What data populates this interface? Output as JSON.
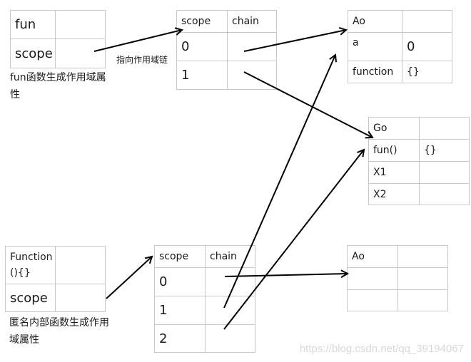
{
  "fun_box": {
    "rows": [
      {
        "key": "fun",
        "value": ""
      },
      {
        "key": "scope",
        "value": ""
      }
    ],
    "caption": "fun函数生成作用域属性"
  },
  "arrow_label": "指向作用域链",
  "scope_chain_top": {
    "header": {
      "key": "scope",
      "value": "chain"
    },
    "rows": [
      {
        "key": "0",
        "value": ""
      },
      {
        "key": "1",
        "value": ""
      }
    ]
  },
  "ao_top": {
    "rows": [
      {
        "key": "Ao",
        "value": ""
      },
      {
        "key": "a",
        "value": "0"
      },
      {
        "key": "function",
        "value": "{}"
      }
    ]
  },
  "go_box": {
    "rows": [
      {
        "key": "Go",
        "value": ""
      },
      {
        "key": "fun()",
        "value": "{}"
      },
      {
        "key": "X1",
        "value": ""
      },
      {
        "key": "X2",
        "value": ""
      }
    ]
  },
  "anon_box": {
    "rows": [
      {
        "key": "Function(){}",
        "value": ""
      },
      {
        "key": "scope",
        "value": ""
      }
    ],
    "caption": "匿名内部函数生成作用域属性"
  },
  "scope_chain_bottom": {
    "header": {
      "key": "scope",
      "value": "chain"
    },
    "rows": [
      {
        "key": "0",
        "value": ""
      },
      {
        "key": "1",
        "value": ""
      },
      {
        "key": "2",
        "value": ""
      }
    ]
  },
  "ao_bottom": {
    "rows": [
      {
        "key": "Ao",
        "value": ""
      },
      {
        "key": "",
        "value": ""
      },
      {
        "key": "",
        "value": ""
      }
    ]
  },
  "edges": [
    {
      "from": "fun.scope",
      "to": "scope_chain_top"
    },
    {
      "from": "scope_chain_top.0",
      "to": "ao_top"
    },
    {
      "from": "scope_chain_top.1",
      "to": "go_box"
    },
    {
      "from": "scope_chain_bottom.0",
      "to": "ao_bottom"
    },
    {
      "from": "scope_chain_bottom.1",
      "to": "ao_top"
    },
    {
      "from": "scope_chain_bottom.2",
      "to": "go_box.fun()"
    },
    {
      "from": "anon.scope",
      "to": "scope_chain_bottom"
    }
  ],
  "watermark": "https://blog.csdn.net/qq_39194067"
}
